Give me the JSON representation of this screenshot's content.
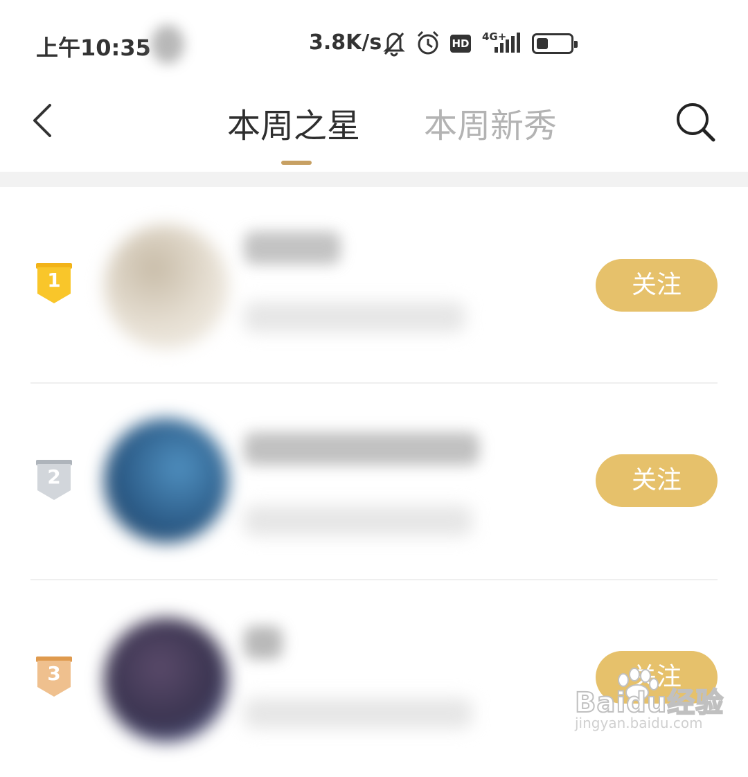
{
  "status_bar": {
    "time": "上午10:35",
    "net_speed": "3.8K/s",
    "hd_label": "HD",
    "network_label": "4G+",
    "battery_level": 0.35,
    "icons": [
      "bell-muted-icon",
      "alarm-icon",
      "hd-icon",
      "signal-icon",
      "battery-icon"
    ]
  },
  "header": {
    "tabs": [
      {
        "label": "本周之星",
        "active": true
      },
      {
        "label": "本周新秀",
        "active": false
      }
    ],
    "accent_color": "#c7a063",
    "icons": [
      "back-icon",
      "search-icon"
    ]
  },
  "list": {
    "items": [
      {
        "rank": "1",
        "medal": "gold",
        "medal_color": "#f5bf1f",
        "follow_label": "关注"
      },
      {
        "rank": "2",
        "medal": "silver",
        "medal_color": "#c9cdd3",
        "follow_label": "关注"
      },
      {
        "rank": "3",
        "medal": "bronze",
        "medal_color": "#e9b67d",
        "follow_label": "关注"
      }
    ],
    "follow_button_color": "#e6c16b"
  },
  "watermark": {
    "brand": "Baidu经验",
    "url": "jingyan.baidu.com"
  }
}
